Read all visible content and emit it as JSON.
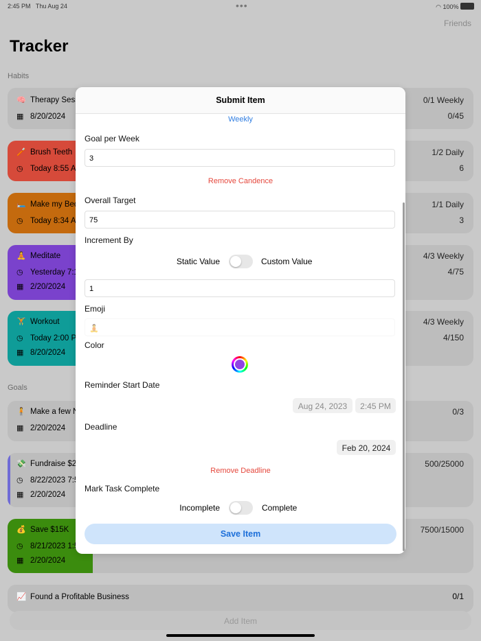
{
  "status": {
    "time": "2:45 PM",
    "date": "Thu Aug 24",
    "battery": "100%",
    "dots": "•••"
  },
  "header": {
    "friends_label": "Friends",
    "title": "Tracker"
  },
  "sections": {
    "habits": "Habits",
    "goals": "Goals"
  },
  "colors": {
    "brush": "#d64a3a",
    "bed": "#c46a0e",
    "meditate": "#7a42cc",
    "workout": "#0f9c98",
    "fundraise": "#6f6bd6",
    "save": "#3b8c0e",
    "accent": "#2f7de1",
    "danger": "#e5473c"
  },
  "habits": [
    {
      "emoji": "🧠",
      "name": "Therapy Sess",
      "line2": "8/20/2024",
      "line2_icon": "calendar-icon",
      "r1": "0/1  Weekly",
      "r2": "0/45"
    },
    {
      "emoji": "🪥",
      "name": "Brush Teeth",
      "line2": "Today 8:55 A",
      "line2_icon": "clock-icon",
      "r1": "1/2  Daily",
      "r2": "6"
    },
    {
      "emoji": "🛏️",
      "name": "Make my Bed",
      "line2": "Today 8:34 A",
      "line2_icon": "clock-icon",
      "r1": "1/1  Daily",
      "r2": "3"
    },
    {
      "emoji": "🧘",
      "name": "Meditate",
      "line2": "Yesterday 7:1",
      "line3": "2/20/2024",
      "r1": "4/3  Weekly",
      "r2": "4/75"
    },
    {
      "emoji": "🏋️",
      "name": "Workout",
      "line2": "Today 2:00 P",
      "line3": "8/20/2024",
      "r1": "4/3  Weekly",
      "r2": "4/150"
    }
  ],
  "goals": [
    {
      "emoji": "🧍",
      "name": "Make a few N",
      "line2": "2/20/2024",
      "r1": "0/3"
    },
    {
      "emoji": "💸",
      "name": "Fundraise $2",
      "line2": "8/22/2023 7:5",
      "line3": "2/20/2024",
      "r1": "500/25000"
    },
    {
      "emoji": "💰",
      "name": "Save $15K",
      "line2": "8/21/2023 1:5",
      "line3": "2/20/2024",
      "r1": "7500/15000"
    },
    {
      "emoji": "📈",
      "name": "Found a Profitable Business",
      "r1": "0/1"
    }
  ],
  "modal": {
    "title": "Submit Item",
    "cadence_value": "Weekly",
    "goal_per_week_label": "Goal per Week",
    "goal_per_week_value": "3",
    "remove_cadence": "Remove Candence",
    "overall_target_label": "Overall Target",
    "overall_target_value": "75",
    "increment_label": "Increment By",
    "static_value_label": "Static Value",
    "custom_value_label": "Custom Value",
    "increment_value": "1",
    "emoji_label": "Emoji",
    "emoji_value": "🧘",
    "color_label": "Color",
    "reminder_label": "Reminder Start Date",
    "reminder_date": "Aug 24, 2023",
    "reminder_time": "2:45 PM",
    "deadline_label": "Deadline",
    "deadline_date": "Feb 20, 2024",
    "remove_deadline": "Remove Deadline",
    "mark_complete_label": "Mark Task Complete",
    "incomplete_label": "Incomplete",
    "complete_label": "Complete",
    "save_label": "Save Item"
  },
  "footer": {
    "add_item": "Add Item"
  }
}
